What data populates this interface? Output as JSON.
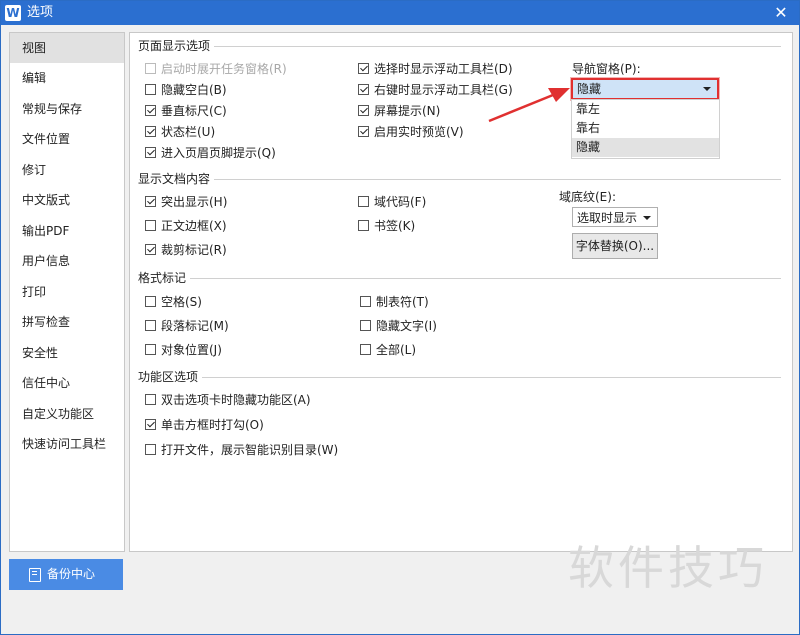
{
  "window": {
    "title": "选项",
    "app_icon_glyph": "W",
    "close_glyph": "✕"
  },
  "sidebar": {
    "items": [
      {
        "label": "视图",
        "active": true
      },
      {
        "label": "编辑"
      },
      {
        "label": "常规与保存"
      },
      {
        "label": "文件位置"
      },
      {
        "label": "修订"
      },
      {
        "label": "中文版式"
      },
      {
        "label": "输出PDF"
      },
      {
        "label": "用户信息"
      },
      {
        "label": "打印"
      },
      {
        "label": "拼写检查"
      },
      {
        "label": "安全性"
      },
      {
        "label": "信任中心"
      },
      {
        "label": "自定义功能区"
      },
      {
        "label": "快速访问工具栏"
      }
    ],
    "backup_button": "备份中心"
  },
  "page_display": {
    "title": "页面显示选项",
    "options": [
      {
        "label": "启动时展开任务窗格(R)",
        "checked": false,
        "disabled": true
      },
      {
        "label": "隐藏空白(B)",
        "checked": false
      },
      {
        "label": "垂直标尺(C)",
        "checked": true
      },
      {
        "label": "状态栏(U)",
        "checked": true
      },
      {
        "label": "进入页眉页脚提示(Q)",
        "checked": true
      },
      {
        "label": "选择时显示浮动工具栏(D)",
        "checked": true
      },
      {
        "label": "右键时显示浮动工具栏(G)",
        "checked": true
      },
      {
        "label": "屏幕提示(N)",
        "checked": true
      },
      {
        "label": "启用实时预览(V)",
        "checked": true
      }
    ],
    "nav_pane_label": "导航窗格(P):",
    "nav_pane_value": "隐藏",
    "nav_pane_options": [
      "靠左",
      "靠右",
      "隐藏"
    ]
  },
  "doc_content": {
    "title": "显示文档内容",
    "options": [
      {
        "label": "突出显示(H)",
        "checked": true
      },
      {
        "label": "正文边框(X)",
        "checked": false
      },
      {
        "label": "裁剪标记(R)",
        "checked": true
      },
      {
        "label": "域代码(F)",
        "checked": false
      },
      {
        "label": "书签(K)",
        "checked": false
      }
    ],
    "field_shading_label": "域底纹(E):",
    "field_shading_value": "选取时显示",
    "font_replace_button": "字体替换(O)..."
  },
  "format_marks": {
    "title": "格式标记",
    "options": [
      {
        "label": "空格(S)",
        "checked": false
      },
      {
        "label": "段落标记(M)",
        "checked": false
      },
      {
        "label": "对象位置(J)",
        "checked": false
      },
      {
        "label": "制表符(T)",
        "checked": false
      },
      {
        "label": "隐藏文字(I)",
        "checked": false
      },
      {
        "label": "全部(L)",
        "checked": false
      }
    ]
  },
  "ribbon": {
    "title": "功能区选项",
    "options": [
      {
        "label": "双击选项卡时隐藏功能区(A)",
        "checked": false
      },
      {
        "label": "单击方框时打勾(O)",
        "checked": true
      },
      {
        "label": "打开文件，展示智能识别目录(W)",
        "checked": false
      }
    ]
  },
  "watermark": "软件技巧",
  "colors": {
    "titlebar": "#2b6fd0",
    "highlight": "#e03030",
    "accent": "#4a8be4"
  }
}
